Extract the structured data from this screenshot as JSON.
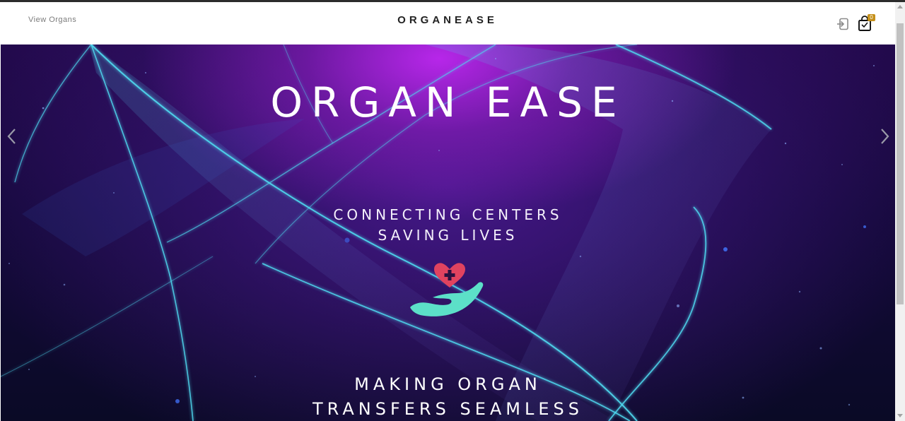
{
  "nav": {
    "view_organs": "View Organs",
    "brand": "ORGANEASE",
    "cart_count": "0",
    "login_icon": "login-icon",
    "cart_icon": "shopping-bag-icon"
  },
  "hero": {
    "title": "ORGAN EASE",
    "tagline_line1": "CONNECTING CENTERS",
    "tagline_line2": "SAVING LIVES",
    "bottom_line1": "MAKING ORGAN",
    "bottom_line2": "TRANSFERS SEAMLESS",
    "logo_icon": "heart-hand-icon",
    "prev_icon": "chevron-left-icon",
    "next_icon": "chevron-right-icon"
  },
  "colors": {
    "accent_gold": "#c5901b",
    "heart": "#e0435f",
    "hand": "#5ce0c8",
    "wave": "#4fd9f0"
  }
}
